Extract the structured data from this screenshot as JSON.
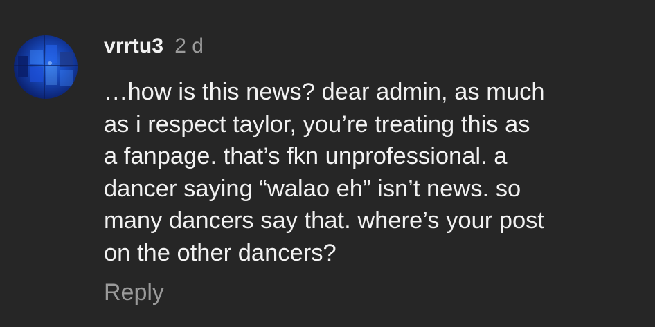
{
  "comment": {
    "avatar_icon": "user-avatar-photo",
    "username": "vrrtu3",
    "timestamp": "2 d",
    "body_lines": [
      "…how is this news? dear admin, as much",
      "as i respect taylor, you’re treating this as",
      "a fanpage. that’s fkn unprofessional. a",
      "dancer saying “walao eh” isn’t news. so",
      "many dancers say that. where’s your post",
      "on the other dancers?"
    ],
    "reply_label": "Reply"
  },
  "colors": {
    "background": "#262626",
    "primary_text": "#f2f2f2",
    "secondary_text": "#9a9a9a",
    "avatar_blue": "#1747b8"
  }
}
